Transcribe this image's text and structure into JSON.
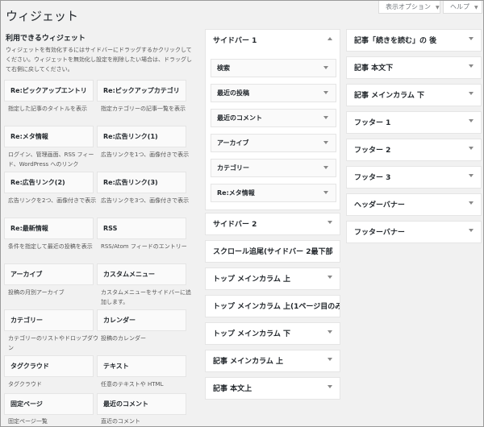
{
  "page_title": "ウィジェット",
  "screen_options": "表示オプション",
  "help": "ヘルプ",
  "available": {
    "heading": "利用できるウィジェット",
    "description": "ウィジェットを有効化するにはサイドバーにドラッグするかクリックしてください。ウィジェットを無効化し設定を削除したい場合は、ドラッグして右側に戻してください。",
    "widgets": [
      {
        "name": "Re:ピックアップエントリ",
        "desc": "指定した記事のタイトルを表示"
      },
      {
        "name": "Re:ピックアップカテゴリ",
        "desc": "指定カテゴリーの記事一覧を表示"
      },
      {
        "name": "Re:メタ情報",
        "desc": "ログイン、管理画面、RSS フィード、WordPress へのリンク"
      },
      {
        "name": "Re:広告リンク(1)",
        "desc": "広告リンクを1つ、画像付きで表示"
      },
      {
        "name": "Re:広告リンク(2)",
        "desc": "広告リンクを2つ、画像付きで表示"
      },
      {
        "name": "Re:広告リンク(3)",
        "desc": "広告リンクを3つ、画像付きで表示"
      },
      {
        "name": "Re:最新情報",
        "desc": "条件を指定して最近の投稿を表示"
      },
      {
        "name": "RSS",
        "desc": "RSS/Atom フィードのエントリー"
      },
      {
        "name": "アーカイブ",
        "desc": "投稿の月別アーカイブ"
      },
      {
        "name": "カスタムメニュー",
        "desc": "カスタムメニューをサイドバーに追加します。"
      },
      {
        "name": "カテゴリー",
        "desc": "カテゴリーのリストやドロップダウン"
      },
      {
        "name": "カレンダー",
        "desc": "投稿のカレンダー"
      },
      {
        "name": "タグクラウド",
        "desc": "タグクラウド"
      },
      {
        "name": "テキスト",
        "desc": "任意のテキストや HTML"
      },
      {
        "name": "固定ページ",
        "desc": "固定ページ一覧"
      },
      {
        "name": "最近のコメント",
        "desc": "直近のコメント"
      }
    ]
  },
  "sidebar_main": {
    "title": "サイドバー 1",
    "widgets": [
      "検索",
      "最近の投稿",
      "最近のコメント",
      "アーカイブ",
      "カテゴリー",
      "Re:メタ情報"
    ]
  },
  "areas_middle": [
    "サイドバー 2",
    "スクロール追尾(サイドバー 2最下部",
    "トップ メインカラム 上",
    "トップ メインカラム 上(1ページ目のみ",
    "トップ メインカラム 下",
    "記事 メインカラム 上",
    "記事 本文上"
  ],
  "areas_right": [
    "記事「続きを読む」の 後",
    "記事 本文下",
    "記事 メインカラム 下",
    "フッター 1",
    "フッター 2",
    "フッター 3",
    "ヘッダーバナー",
    "フッターバナー"
  ]
}
